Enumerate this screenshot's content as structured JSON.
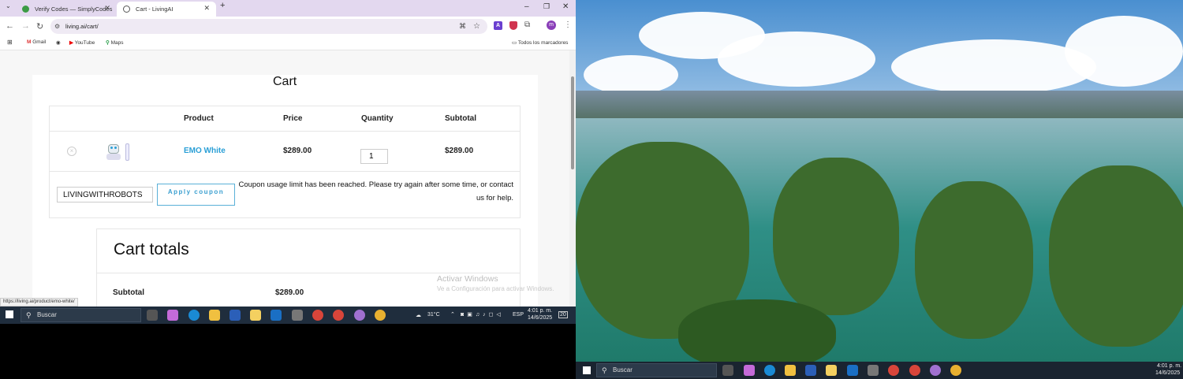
{
  "browser": {
    "tabs": [
      {
        "title": "Verify Codes — SimplyCodes",
        "active": false
      },
      {
        "title": "Cart - LivingAI",
        "active": true
      }
    ],
    "url": "living.ai/cart/",
    "bookmarks": [
      "Gmail",
      "YouTube",
      "Maps"
    ],
    "bookmarks_folder": "Todos los marcadores",
    "profile_initial": "m"
  },
  "page": {
    "title": "Cart",
    "table_headers": [
      "Product",
      "Price",
      "Quantity",
      "Subtotal"
    ],
    "item": {
      "name": "EMO White",
      "price": "$289.00",
      "quantity": "1",
      "subtotal": "$289.00"
    },
    "coupon_code": "LIVINGWITHROBOTS",
    "apply_label": "Apply coupon",
    "error": "Coupon usage limit has been reached. Please try again after some time, or contact us for help.",
    "totals_title": "Cart totals",
    "totals_rows": [
      {
        "label": "Subtotal",
        "value": "$289.00"
      }
    ],
    "status_url": "https://living.ai/product/emo-white/",
    "watermark_title": "Activar Windows",
    "watermark_sub": "Ve a Configuración para activar Windows."
  },
  "taskbar": {
    "search_placeholder": "Buscar",
    "weather": "31°C",
    "lang": "ESP",
    "time": "4:01 p. m.",
    "date": "14/6/2025",
    "notifications": "20"
  },
  "taskbar2": {
    "search_placeholder": "Buscar",
    "time": "4:01 p. m.",
    "date": "14/6/2025"
  },
  "colors": {
    "link": "#2a9fd6",
    "tabstrip": "#e3d8ef",
    "taskbar": "#1f2d3d"
  }
}
